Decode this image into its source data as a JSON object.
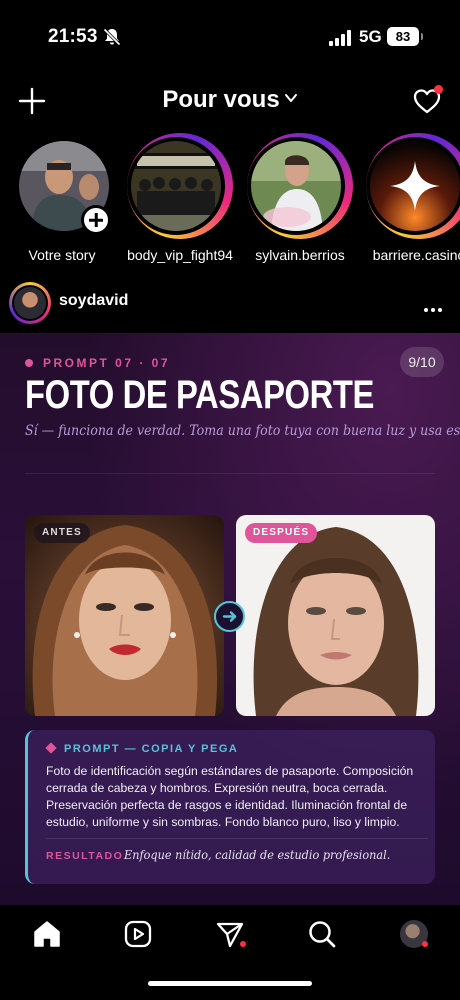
{
  "status_bar": {
    "time": "21:53",
    "network": "5G",
    "battery": "83"
  },
  "header": {
    "title": "Pour vous"
  },
  "stories": [
    {
      "name": "Votre story",
      "own": true
    },
    {
      "name": "body_vip_fight94"
    },
    {
      "name": "sylvain.berrios"
    },
    {
      "name": "barriere.casino"
    }
  ],
  "post": {
    "username": "soydavid",
    "tag": "PROMPT 07 · 07",
    "counter": "9/10",
    "title": "FOTO DE PASAPORTE",
    "subtitle": "Sí — funciona de verdad. Toma una foto tuya con buena luz y usa esto.",
    "before_label": "ANTES",
    "after_label": "DESPUÉS",
    "prompt_heading": "PROMPT — COPIA Y PEGA",
    "prompt_text": "Foto de identificación según estándares de pasaporte. Composición cerrada de cabeza y hombros. Expresión neutra, boca cerrada. Preservación perfecta de rasgos e identidad. Iluminación frontal de estudio, uniforme y sin sombras. Fondo blanco puro, liso y limpio.",
    "result_label": "RESULTADO",
    "result_text": "Enfoque nítido, calidad de estudio profesional."
  },
  "colors": {
    "accent_pink": "#e0559a",
    "accent_cyan": "#58c3d8",
    "notification_red": "#ff3040"
  }
}
